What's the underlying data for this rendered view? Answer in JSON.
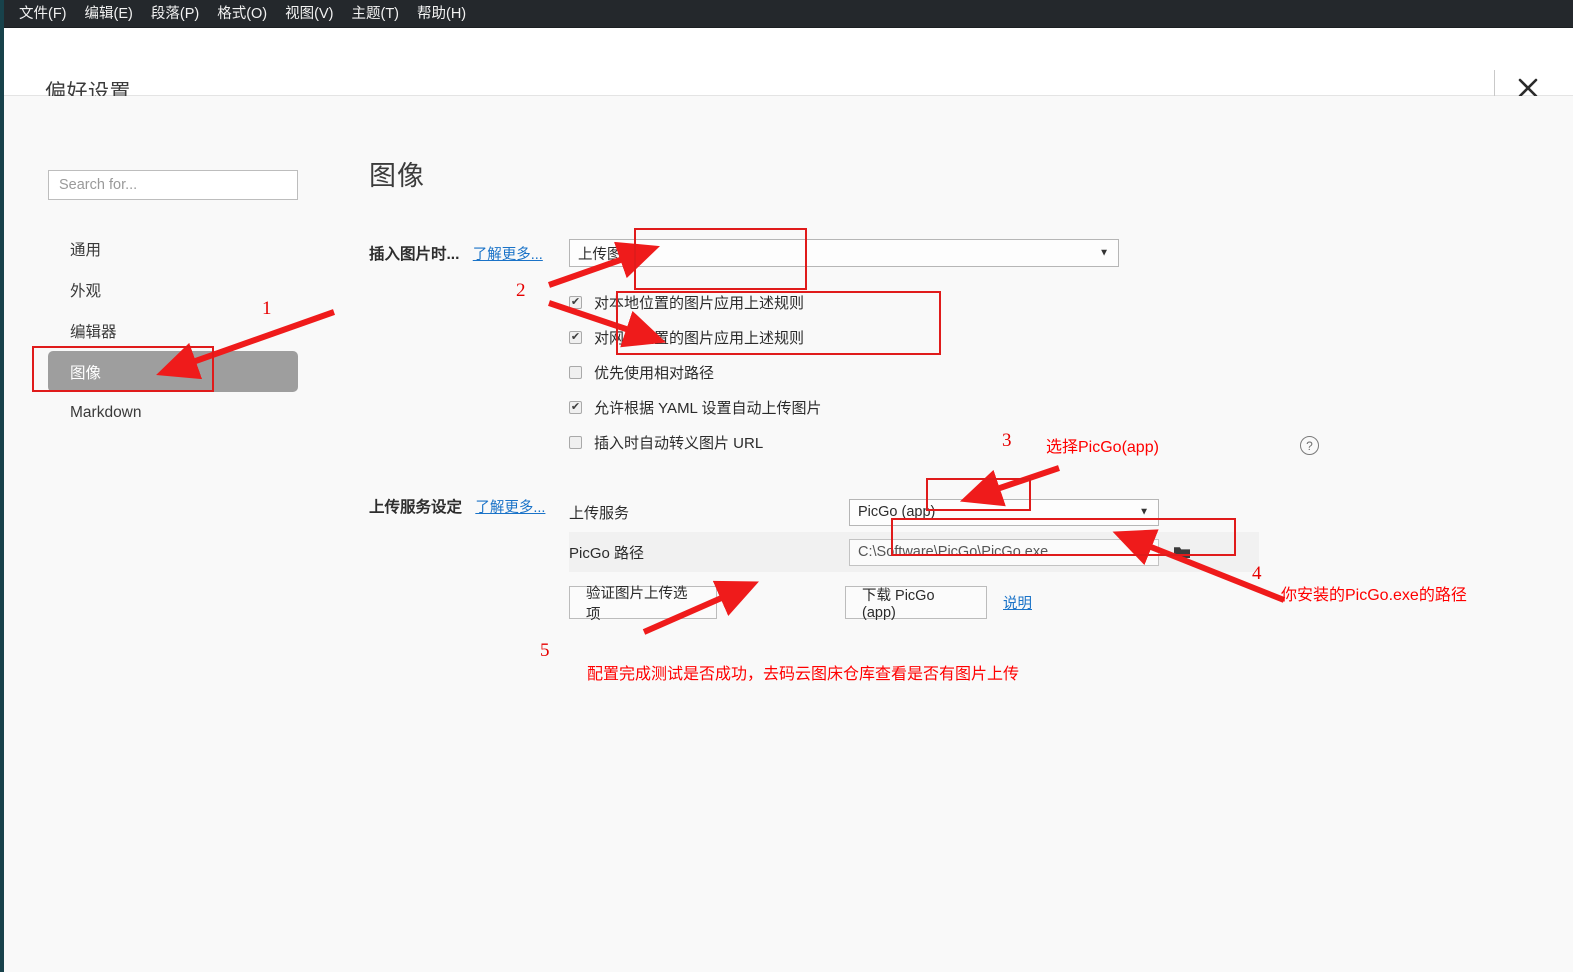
{
  "menubar": {
    "items": [
      {
        "label": "文件(F)",
        "name": "menu-file"
      },
      {
        "label": "编辑(E)",
        "name": "menu-edit"
      },
      {
        "label": "段落(P)",
        "name": "menu-paragraph"
      },
      {
        "label": "格式(O)",
        "name": "menu-format"
      },
      {
        "label": "视图(V)",
        "name": "menu-view"
      },
      {
        "label": "主题(T)",
        "name": "menu-theme"
      },
      {
        "label": "帮助(H)",
        "name": "menu-help"
      }
    ]
  },
  "titlebar": {
    "title": "偏好设置",
    "close_icon": "close-icon"
  },
  "sidebar": {
    "search_placeholder": "Search for...",
    "search_value": "",
    "items": [
      {
        "label": "通用",
        "selected": false
      },
      {
        "label": "外观",
        "selected": false
      },
      {
        "label": "编辑器",
        "selected": false
      },
      {
        "label": "图像",
        "selected": true
      },
      {
        "label": "Markdown",
        "selected": false
      }
    ]
  },
  "main": {
    "page_title": "图像",
    "insert_section": {
      "label": "插入图片时...",
      "learn_more": "了解更多...",
      "dropdown_value": "上传图片",
      "caret_icon": "chevron-down-icon",
      "checkboxes": [
        {
          "label": "对本地位置的图片应用上述规则",
          "checked": true
        },
        {
          "label": "对网络位置的图片应用上述规则",
          "checked": true
        },
        {
          "label": "优先使用相对路径",
          "checked": false
        },
        {
          "label": "允许根据 YAML 设置自动上传图片",
          "checked": true
        },
        {
          "label": "插入时自动转义图片 URL",
          "checked": false
        }
      ]
    },
    "upload_section": {
      "label": "上传服务设定",
      "learn_more": "了解更多...",
      "help_icon": "help-circle-icon",
      "rows": [
        {
          "name": "上传服务",
          "value": "PicGo (app)",
          "type": "select"
        },
        {
          "name": "PicGo 路径",
          "value": "C:\\Software\\PicGo\\PicGo.exe",
          "type": "path"
        }
      ],
      "folder_icon": "folder-icon",
      "verify_button": "验证图片上传选项",
      "download_button": "下载 PicGo (app)",
      "instructions_link": "说明"
    }
  },
  "annotations": {
    "color": "#ff0000",
    "items": [
      {
        "number": "1",
        "text": ""
      },
      {
        "number": "2",
        "text": ""
      },
      {
        "number": "3",
        "text": "选择PicGo(app)"
      },
      {
        "number": "4",
        "text": "你安装的PicGo.exe的路径"
      },
      {
        "number": "5",
        "text": "配置完成测试是否成功，去码云图床仓库查看是否有图片上传"
      }
    ]
  }
}
